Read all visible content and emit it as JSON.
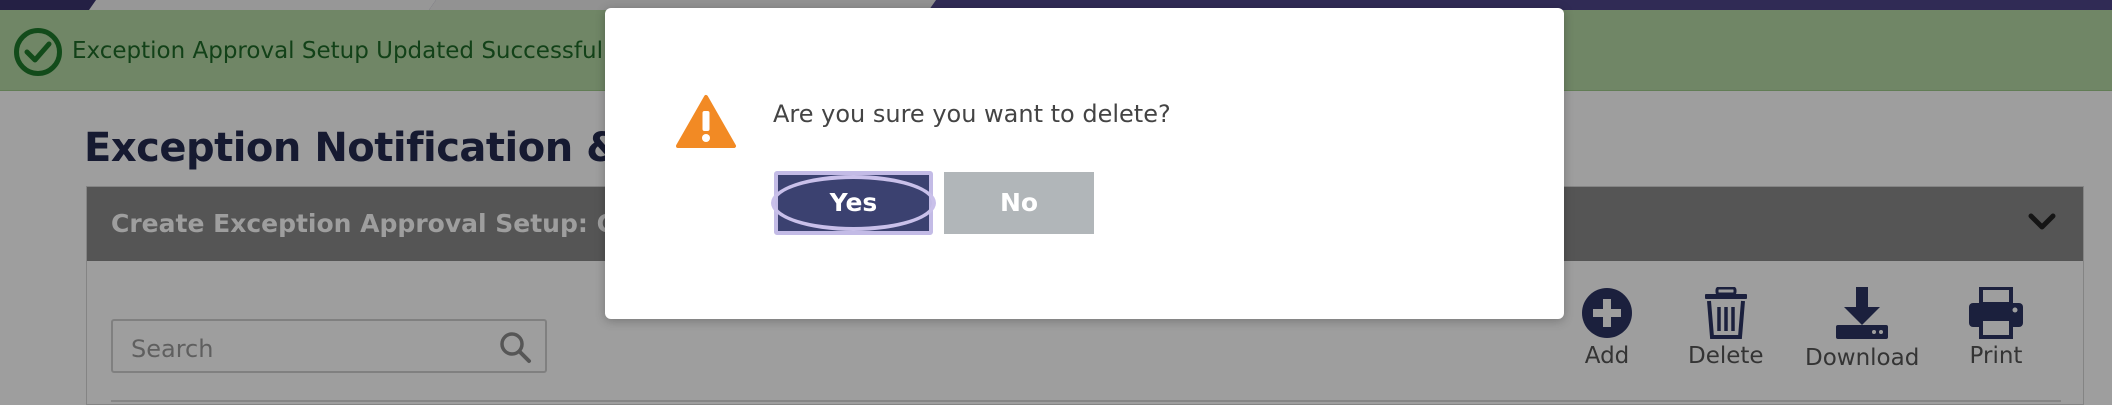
{
  "banner": {
    "message": "Exception Approval Setup Updated Successfull"
  },
  "page": {
    "title": "Exception Notification & Ap"
  },
  "panel": {
    "title": "Create Exception Approval Setup: C"
  },
  "search": {
    "placeholder": "Search"
  },
  "toolbar": {
    "add_label": "Add",
    "delete_label": "Delete",
    "download_label": "Download",
    "print_label": "Print"
  },
  "dialog": {
    "question": "Are you sure you want to delete?",
    "yes_label": "Yes",
    "no_label": "No",
    "icons": {
      "warning": "warning-triangle-icon",
      "close": "close-icon"
    }
  },
  "colors": {
    "nav": "#4e4689",
    "banner_bg": "#b5d9a5",
    "banner_text": "#1d6a27",
    "title_text": "#252a4f",
    "panel_header": "#8a8a8a",
    "yes_button": "#3b4170",
    "no_button": "#b1b6b9",
    "warning": "#f28a24"
  }
}
